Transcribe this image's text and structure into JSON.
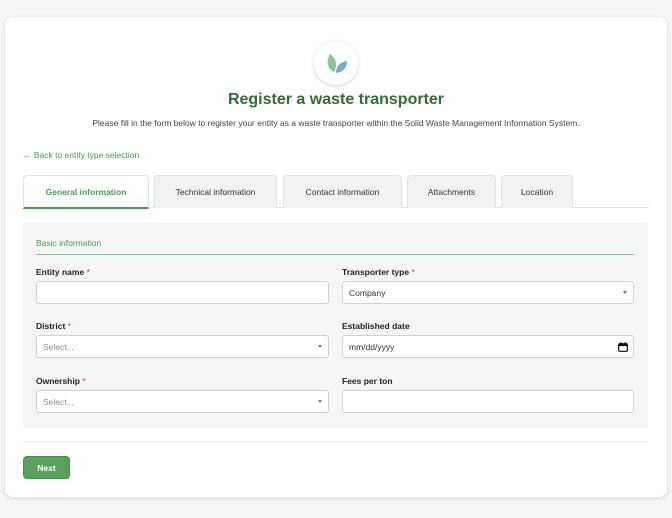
{
  "header": {
    "logo_icon": "leaf-icon",
    "title": "Register a waste transporter",
    "subtitle": "Please fill in the form below to register your entity as a waste transporter within the Solid Waste Management Information System."
  },
  "back_link": "← Back to entity type selection",
  "tabs": [
    {
      "label": "General information",
      "active": true
    },
    {
      "label": "Technical information",
      "active": false
    },
    {
      "label": "Contact information",
      "active": false
    },
    {
      "label": "Attachments",
      "active": false
    },
    {
      "label": "Location",
      "active": false
    }
  ],
  "section": {
    "title": "Basic information"
  },
  "form": {
    "entity_name": {
      "label": "Entity name",
      "required_mark": "*",
      "value": ""
    },
    "transporter_type": {
      "label": "Transporter type",
      "required_mark": "*",
      "value": "Company"
    },
    "district": {
      "label": "District",
      "required_mark": "*",
      "placeholder": "Select..."
    },
    "established_date": {
      "label": "Established date",
      "placeholder": "mm/dd/yyyy"
    },
    "ownership": {
      "label": "Ownership",
      "required_mark": "*",
      "placeholder": "Select..."
    },
    "fees_per_ton": {
      "label": "Fees per ton",
      "value": ""
    }
  },
  "actions": {
    "next_label": "Next"
  },
  "colors": {
    "primary_green": "#4e9a53",
    "title_green": "#2f6e35",
    "required_red": "#d9383a"
  }
}
